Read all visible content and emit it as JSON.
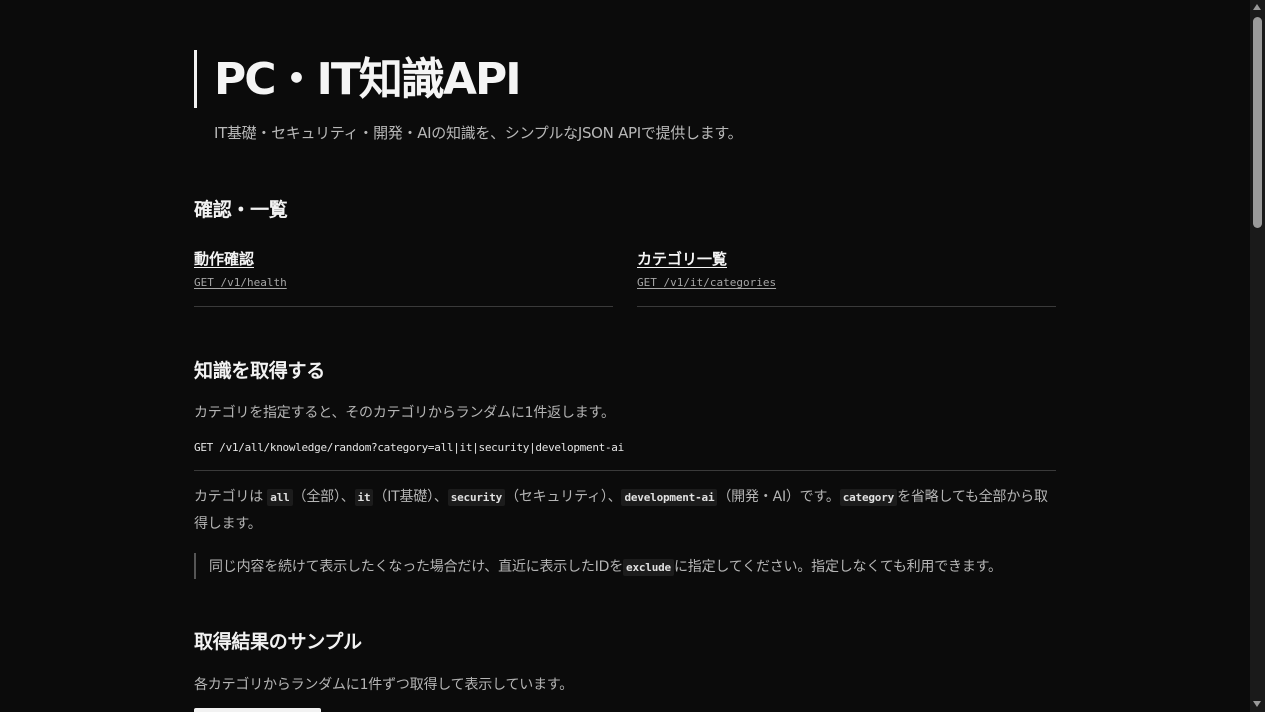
{
  "header": {
    "title": "PC・IT知識API",
    "subtitle": "IT基礎・セキュリティ・開発・AIの知識を、シンプルなJSON APIで提供します。"
  },
  "section_overview": {
    "heading": "確認・一覧",
    "cards": [
      {
        "title": "動作確認",
        "path": "GET /v1/health"
      },
      {
        "title": "カテゴリ一覧",
        "path": "GET /v1/it/categories"
      }
    ]
  },
  "section_knowledge": {
    "heading": "知識を取得する",
    "description": "カテゴリを指定すると、そのカテゴリからランダムに1件返します。",
    "endpoint": "GET /v1/all/knowledge/random?category=all|it|security|development-ai",
    "categories_text": {
      "prefix": "カテゴリは",
      "all_code": "all",
      "all_label": "（全部）、",
      "it_code": "it",
      "it_label": "（IT基礎）、",
      "security_code": "security",
      "security_label": "（セキュリティ）、",
      "devai_code": "development-ai",
      "devai_label": "（開発・AI）です。",
      "category_code": "category",
      "suffix": "を省略しても全部から取得します。"
    },
    "note": {
      "before": "同じ内容を続けて表示したくなった場合だけ、直近に表示したIDを",
      "code": "exclude",
      "after": "に指定してください。指定しなくても利用できます。"
    }
  },
  "section_sample": {
    "heading": "取得結果のサンプル",
    "description": "各カテゴリからランダムに1件ずつ取得して表示しています。"
  },
  "scrollbar": {
    "up_icon": "scroll-up-arrow-icon",
    "down_icon": "scroll-down-arrow-icon"
  }
}
